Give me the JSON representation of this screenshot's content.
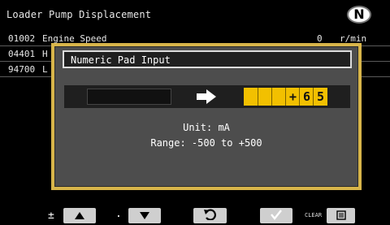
{
  "header": {
    "title": "Loader Pump Displacement",
    "badge": "N"
  },
  "rows": [
    {
      "code": "01002",
      "name": "Engine Speed",
      "value": "0",
      "unit": "r/min"
    },
    {
      "code": "04401",
      "name": "H",
      "value": "",
      "unit": ""
    },
    {
      "code": "94700",
      "name": "L",
      "value": "",
      "unit": ""
    }
  ],
  "dialog": {
    "title": "Numeric Pad Input",
    "entry_value": "",
    "digits": [
      "",
      "",
      "",
      "+",
      "6",
      "5"
    ],
    "unit_text": "Unit: mA",
    "range_text": "Range: -500 to +500"
  },
  "bottom_bar": {
    "plus_minus_label": "±",
    "dot_label": ".",
    "clear_label": "CLEAR"
  },
  "colors": {
    "dialog_border": "#d8b54a",
    "digit_bg": "#f2c000",
    "dialog_bg": "#4d4d4d"
  },
  "icons": [
    "up-triangle-icon",
    "down-triangle-icon",
    "undo-icon",
    "check-icon",
    "clear-icon",
    "right-arrow-icon"
  ]
}
